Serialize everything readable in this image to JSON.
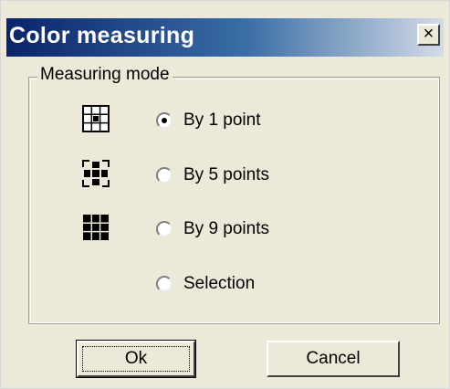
{
  "window": {
    "title": "Color measuring",
    "close_glyph": "×"
  },
  "group": {
    "label": "Measuring mode"
  },
  "modes": [
    {
      "label": "By 1 point",
      "icon": "grid-1-point-icon",
      "selected": true
    },
    {
      "label": "By 5 points",
      "icon": "grid-5-points-icon",
      "selected": false
    },
    {
      "label": "By 9 points",
      "icon": "grid-9-points-icon",
      "selected": false
    },
    {
      "label": "Selection",
      "icon": "",
      "selected": false
    }
  ],
  "buttons": {
    "ok_label": "Ok",
    "cancel_label": "Cancel"
  },
  "colors": {
    "titlebar_start": "#0a246a",
    "titlebar_end": "#d4dbe8",
    "dialog_bg": "#ece9d8"
  }
}
